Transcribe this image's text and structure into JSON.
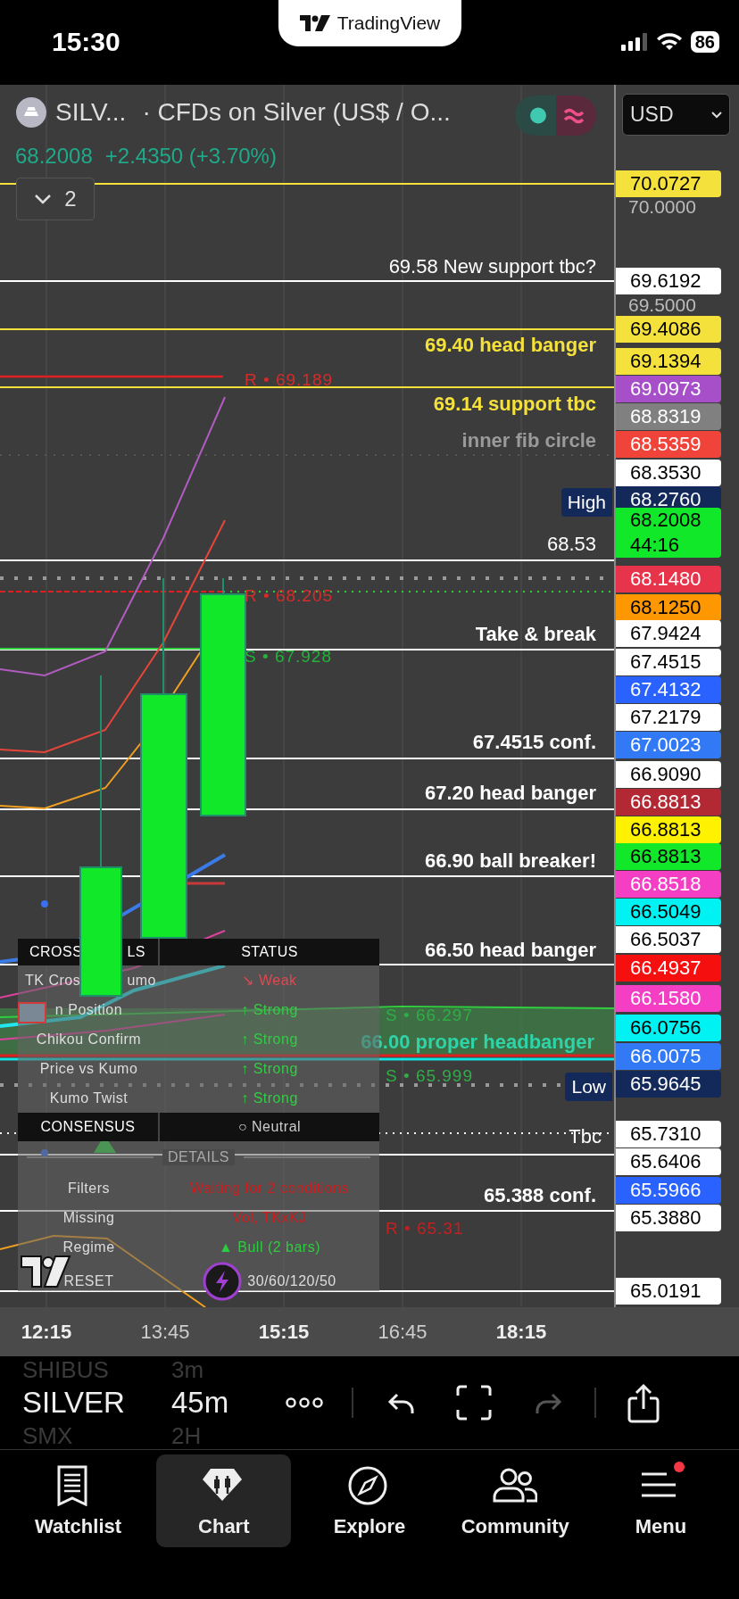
{
  "status_bar": {
    "time": "15:30",
    "battery": "86"
  },
  "app_pill": {
    "title": "TradingView"
  },
  "symbol_header": {
    "short_name": "SILV...",
    "description": "· CFDs on Silver (US$ / O...",
    "price": "68.2008",
    "change": "+2.4350 (+3.70%)"
  },
  "currency_select": {
    "value": "USD"
  },
  "collapse_button": {
    "label": "2"
  },
  "annotations": [
    {
      "text": "69.58 New support tbc?",
      "kind": "note",
      "color": "#ffffff"
    },
    {
      "text": "69.40 head banger",
      "kind": "level",
      "color": "#f5e13c"
    },
    {
      "text": "R • 69.189",
      "kind": "marker",
      "color": "#d62b2b"
    },
    {
      "text": "69.14 support tbc",
      "kind": "level",
      "color": "#f5e13c"
    },
    {
      "text": "inner fib circle",
      "kind": "level",
      "color": "#9a9a9a"
    },
    {
      "text": "High",
      "kind": "badge",
      "color": "#13295a"
    },
    {
      "text": "68.53",
      "kind": "note",
      "color": "#ffffff"
    },
    {
      "text": "R • 68.205",
      "kind": "marker",
      "color": "#d62b2b"
    },
    {
      "text": "Take & break",
      "kind": "level",
      "color": "#ffffff"
    },
    {
      "text": "S • 67.928",
      "kind": "marker",
      "color": "#22b33a"
    },
    {
      "text": "67.4515 conf.",
      "kind": "level",
      "color": "#ffffff"
    },
    {
      "text": "67.20 head banger",
      "kind": "level",
      "color": "#ffffff"
    },
    {
      "text": "66.90 ball breaker!",
      "kind": "level",
      "color": "#ffffff"
    },
    {
      "text": "66.50 head banger",
      "kind": "level",
      "color": "#ffffff"
    },
    {
      "text": "S • 66.297",
      "kind": "marker",
      "color": "#2fae48"
    },
    {
      "text": "66.00 proper headbanger",
      "kind": "level",
      "color": "#2ed3a8"
    },
    {
      "text": "S • 65.999",
      "kind": "marker",
      "color": "#2fae48"
    },
    {
      "text": "Low",
      "kind": "badge",
      "color": "#13295a"
    },
    {
      "text": "Tbc",
      "kind": "note",
      "color": "#ffffff"
    },
    {
      "text": "65.388 conf.",
      "kind": "level",
      "color": "#ffffff"
    },
    {
      "text": "R • 65.31",
      "kind": "marker",
      "color": "#c42020"
    }
  ],
  "signal_table": {
    "header": {
      "left": "CROSS",
      "tail": "LS",
      "status": "STATUS"
    },
    "rows": [
      {
        "label": "TK Cros",
        "label_tail": "umo",
        "status": "↘ Weak",
        "color": "#e0484f"
      },
      {
        "label": "n Position",
        "status": "↑ Strong",
        "color": "#33cc44"
      },
      {
        "label": "Chikou Confirm",
        "status": "↑ Strong",
        "color": "#33cc44"
      },
      {
        "label": "Price vs Kumo",
        "status": "↑ Strong",
        "color": "#33cc44"
      },
      {
        "label": "Kumo Twist",
        "status": "↑ Strong",
        "color": "#33cc44"
      }
    ],
    "consensus": {
      "label": "CONSENSUS",
      "status": "○ Neutral"
    },
    "details_title": "DETAILS",
    "details": [
      {
        "label": "Filters",
        "value": "Waiting for 2 conditions",
        "color": "#c81e1e",
        "kind": "info"
      },
      {
        "label": "Missing",
        "value": "Vol, TKxKJ",
        "color": "#c81e1e",
        "kind": "info"
      },
      {
        "label": "Regime",
        "value": "▲ Bull (2 bars)",
        "color": "#2ecc40",
        "kind": "info"
      },
      {
        "label": "RESET",
        "value": "30/60/120/50",
        "color": "#dddddd",
        "kind": "preset"
      }
    ]
  },
  "price_axis": {
    "ticks": [
      "70.0000",
      "69.5000"
    ],
    "labels": [
      {
        "text": "70.0727",
        "color": "#f5e13c"
      },
      {
        "text": "69.6192",
        "color": "#ffffff"
      },
      {
        "text": "69.4086",
        "color": "#f5e13c"
      },
      {
        "text": "69.1394",
        "color": "#f5e13c"
      },
      {
        "text": "69.0973",
        "color": "#a64fc9"
      },
      {
        "text": "68.8319",
        "color": "#808080"
      },
      {
        "text": "68.5359",
        "color": "#f0443a"
      },
      {
        "text": "68.3530",
        "color": "#ffffff"
      },
      {
        "text": "68.2760",
        "color": "#13295a"
      },
      {
        "text": "68.2008",
        "color": "#12e82a",
        "countdown": "44:16"
      },
      {
        "text": "68.1480",
        "color": "#e8344a"
      },
      {
        "text": "68.1250",
        "color": "#ff9800"
      },
      {
        "text": "67.9424",
        "color": "#ffffff"
      },
      {
        "text": "67.4515",
        "color": "#ffffff"
      },
      {
        "text": "67.4132",
        "color": "#2962ff"
      },
      {
        "text": "67.2179",
        "color": "#ffffff"
      },
      {
        "text": "67.0023",
        "color": "#3179f5"
      },
      {
        "text": "66.9090",
        "color": "#ffffff"
      },
      {
        "text": "66.8813",
        "color": "#b22833"
      },
      {
        "text": "66.8813",
        "color": "#fff200"
      },
      {
        "text": "66.8813",
        "color": "#12e82a"
      },
      {
        "text": "66.8518",
        "color": "#f43fc4"
      },
      {
        "text": "66.5049",
        "color": "#00f2f2"
      },
      {
        "text": "66.5037",
        "color": "#ffffff"
      },
      {
        "text": "66.4937",
        "color": "#f50f0f"
      },
      {
        "text": "66.1580",
        "color": "#f43fc4"
      },
      {
        "text": "66.0756",
        "color": "#00f2f2"
      },
      {
        "text": "66.0075",
        "color": "#3179f5"
      },
      {
        "text": "65.9645",
        "color": "#13295a"
      },
      {
        "text": "65.7310",
        "color": "#ffffff"
      },
      {
        "text": "65.6406",
        "color": "#ffffff"
      },
      {
        "text": "65.5966",
        "color": "#2962ff"
      },
      {
        "text": "65.3880",
        "color": "#ffffff"
      },
      {
        "text": "65.0191",
        "color": "#ffffff"
      }
    ]
  },
  "time_axis": [
    {
      "label": "12:15",
      "major": true
    },
    {
      "label": "13:45",
      "major": false
    },
    {
      "label": "15:15",
      "major": true
    },
    {
      "label": "16:45",
      "major": false
    },
    {
      "label": "18:15",
      "major": true
    }
  ],
  "toolbar": {
    "symbol": "SILVER",
    "interval": "45m",
    "symbol_above": "SHIBUS",
    "interval_above": "3m",
    "symbol_below": "SMX",
    "interval_below": "2H",
    "buttons": [
      {
        "kind": "more",
        "disabled": false
      },
      {
        "kind": "undo",
        "disabled": false
      },
      {
        "kind": "fullscreen",
        "disabled": false
      },
      {
        "kind": "redo",
        "disabled": true
      },
      {
        "kind": "share",
        "disabled": false
      }
    ]
  },
  "tab_bar": [
    {
      "label": "Watchlist",
      "kind": "watchlist",
      "selected": false,
      "notification": false
    },
    {
      "label": "Chart",
      "kind": "chart",
      "selected": true,
      "notification": false
    },
    {
      "label": "Explore",
      "kind": "explore",
      "selected": false,
      "notification": false
    },
    {
      "label": "Community",
      "kind": "community",
      "selected": false,
      "notification": false
    },
    {
      "label": "Menu",
      "kind": "menu",
      "selected": false,
      "notification": true
    }
  ]
}
